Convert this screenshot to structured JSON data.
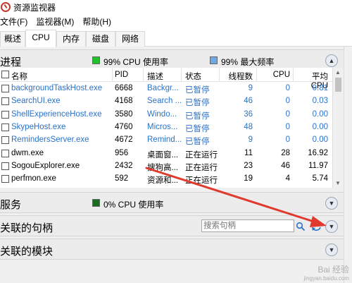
{
  "window": {
    "title": "资源监视器"
  },
  "menu": [
    "文件(F)",
    "监视器(M)",
    "帮助(H)"
  ],
  "tabs": [
    "概述",
    "CPU",
    "内存",
    "磁盘",
    "网络"
  ],
  "processes": {
    "title": "进程",
    "cpu_status": "99% CPU 使用率",
    "freq_status": "99% 最大频率",
    "columns": [
      "名称",
      "PID",
      "描述",
      "状态",
      "线程数",
      "CPU",
      "平均 CPU"
    ],
    "rows": [
      {
        "name": "backgroundTaskHost.exe",
        "pid": "6668",
        "desc": "Backgr...",
        "status": "已暂停",
        "threads": "9",
        "cpu": "0",
        "avg": "0.81",
        "suspended": true
      },
      {
        "name": "SearchUI.exe",
        "pid": "4168",
        "desc": "Search ...",
        "status": "已暂停",
        "threads": "46",
        "cpu": "0",
        "avg": "0.03",
        "suspended": true
      },
      {
        "name": "ShellExperienceHost.exe",
        "pid": "3580",
        "desc": "Windo...",
        "status": "已暂停",
        "threads": "36",
        "cpu": "0",
        "avg": "0.00",
        "suspended": true
      },
      {
        "name": "SkypeHost.exe",
        "pid": "4760",
        "desc": "Micros...",
        "status": "已暂停",
        "threads": "48",
        "cpu": "0",
        "avg": "0.00",
        "suspended": true
      },
      {
        "name": "RemindersServer.exe",
        "pid": "4672",
        "desc": "Remind...",
        "status": "已暂停",
        "threads": "9",
        "cpu": "0",
        "avg": "0.00",
        "suspended": true
      },
      {
        "name": "dwm.exe",
        "pid": "956",
        "desc": "桌面窗...",
        "status": "正在运行",
        "threads": "11",
        "cpu": "28",
        "avg": "16.92",
        "suspended": false
      },
      {
        "name": "SogouExplorer.exe",
        "pid": "2432",
        "desc": "搜狗高...",
        "status": "正在运行",
        "threads": "23",
        "cpu": "46",
        "avg": "11.97",
        "suspended": false
      },
      {
        "name": "perfmon.exe",
        "pid": "592",
        "desc": "资源和...",
        "status": "正在运行",
        "threads": "19",
        "cpu": "4",
        "avg": "5.74",
        "suspended": false
      }
    ]
  },
  "services": {
    "title": "服务",
    "cpu_status": "0% CPU 使用率"
  },
  "handles": {
    "title": "关联的句柄",
    "search_placeholder": "搜索句柄"
  },
  "modules": {
    "title": "关联的模块"
  },
  "colors": {
    "cpu_green": "#22c22e",
    "freq_blue": "#6fa8ea",
    "service_green": "#1c6b22",
    "suspended_text": "#2a72c9",
    "annotation_arrow": "#e03a2e"
  },
  "watermark": {
    "line1": "Bai 经验",
    "line2": "jingyan.baidu.com"
  }
}
